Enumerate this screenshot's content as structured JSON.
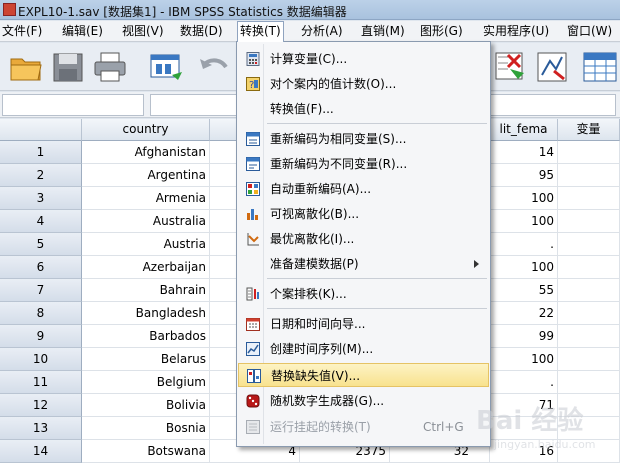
{
  "window": {
    "title": "EXPL10-1.sav [数据集1] - IBM SPSS Statistics 数据编辑器"
  },
  "menubar": [
    {
      "label": "文件(F)"
    },
    {
      "label": "编辑(E)"
    },
    {
      "label": "视图(V)"
    },
    {
      "label": "数据(D)"
    },
    {
      "label": "转换(T)"
    },
    {
      "label": "分析(A)"
    },
    {
      "label": "直销(M)"
    },
    {
      "label": "图形(G)"
    },
    {
      "label": "实用程序(U)"
    },
    {
      "label": "窗口(W)"
    }
  ],
  "toolbar": {
    "icons": [
      "open-folder-icon",
      "save-icon",
      "print-icon",
      "dialog-recall-icon",
      "undo-icon",
      "select-cases-icon",
      "weight-cases-icon",
      "value-labels-icon"
    ]
  },
  "grid": {
    "columns": [
      {
        "label": "country"
      },
      {
        "label": ""
      },
      {
        "label": "lit_fema"
      },
      {
        "label": "变量"
      }
    ],
    "rows": [
      {
        "n": "1",
        "country": "Afghanistan",
        "col4": "",
        "col5": "",
        "lit_fema": "14"
      },
      {
        "n": "2",
        "country": "Argentina",
        "col4": "",
        "col5": "",
        "lit_fema": "95"
      },
      {
        "n": "3",
        "country": "Armenia",
        "col4": "",
        "col5": "",
        "lit_fema": "100"
      },
      {
        "n": "4",
        "country": "Australia",
        "col4": "",
        "col5": "",
        "lit_fema": "100"
      },
      {
        "n": "5",
        "country": "Austria",
        "col4": "",
        "col5": "",
        "lit_fema": "."
      },
      {
        "n": "6",
        "country": "Azerbaijan",
        "col4": "",
        "col5": "",
        "lit_fema": "100"
      },
      {
        "n": "7",
        "country": "Bahrain",
        "col4": "",
        "col5": "",
        "lit_fema": "55"
      },
      {
        "n": "8",
        "country": "Bangladesh",
        "col4": "",
        "col5": "",
        "lit_fema": "22"
      },
      {
        "n": "9",
        "country": "Barbados",
        "col4": "",
        "col5": "",
        "lit_fema": "99"
      },
      {
        "n": "10",
        "country": "Belarus",
        "col4": "",
        "col5": "",
        "lit_fema": "100"
      },
      {
        "n": "11",
        "country": "Belgium",
        "col4": "",
        "col5": "",
        "lit_fema": "."
      },
      {
        "n": "12",
        "country": "Bolivia",
        "col4": "",
        "col5": "",
        "lit_fema": "71"
      },
      {
        "n": "13",
        "country": "Bosnia",
        "col4": "",
        "col5": "",
        "lit_fema": ""
      },
      {
        "n": "14",
        "country": "Botswana",
        "col4": "4",
        "col5": "2375",
        "lit_fema": "16",
        "col_extra": "32"
      }
    ]
  },
  "transform_menu": {
    "items": [
      {
        "label": "计算变量(C)...",
        "icon": "calculator-icon"
      },
      {
        "label": "对个案内的值计数(O)...",
        "icon": "count-icon"
      },
      {
        "label": "转换值(F)...",
        "icon": ""
      },
      {
        "label": "重新编码为相同变量(S)...",
        "icon": "recode-same-icon"
      },
      {
        "label": "重新编码为不同变量(R)...",
        "icon": "recode-different-icon"
      },
      {
        "label": "自动重新编码(A)...",
        "icon": "auto-recode-icon"
      },
      {
        "label": "可视离散化(B)...",
        "icon": "visual-binning-icon"
      },
      {
        "label": "最优离散化(I)...",
        "icon": "optimal-binning-icon"
      },
      {
        "label": "准备建模数据(P)",
        "icon": "",
        "submenu": true
      },
      {
        "label": "个案排秩(K)...",
        "icon": "rank-cases-icon"
      },
      {
        "label": "日期和时间向导...",
        "icon": "calendar-icon"
      },
      {
        "label": "创建时间序列(M)...",
        "icon": "time-series-icon"
      },
      {
        "label": "替换缺失值(V)...",
        "icon": "replace-missing-icon"
      },
      {
        "label": "随机数字生成器(G)...",
        "icon": "dice-icon"
      },
      {
        "label": "运行挂起的转换(T)",
        "icon": "run-pending-icon",
        "shortcut": "Ctrl+G"
      }
    ]
  },
  "watermark": {
    "text": "Bai 经验",
    "subtext": "jingyan.baidu.com"
  }
}
